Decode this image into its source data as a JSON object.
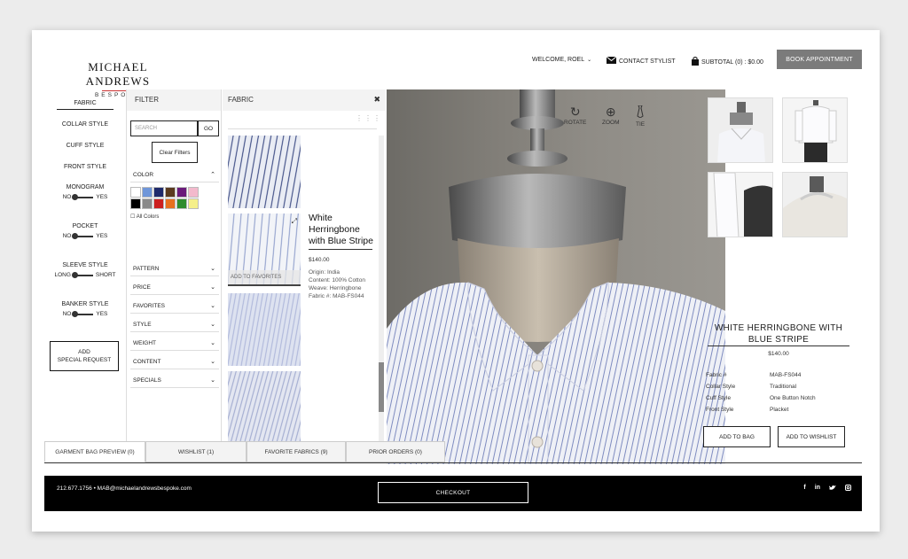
{
  "header": {
    "logo_name": "MICHAEL ANDREWS",
    "logo_sub": "BESPOKE",
    "welcome": "WELCOME, ROEL",
    "contact": "CONTACT STYLIST",
    "subtotal": "SUBTOTAL (0) : $0.00",
    "book": "BOOK APPOINTMENT"
  },
  "leftnav": {
    "fabric": "FABRIC",
    "collar": "COLLAR STYLE",
    "cuff": "CUFF STYLE",
    "front": "FRONT STYLE",
    "monogram": "MONOGRAM",
    "pocket": "POCKET",
    "sleeve": "SLEEVE STYLE",
    "banker": "BANKER STYLE",
    "no": "NO",
    "yes": "YES",
    "long": "LONG",
    "short": "SHORT",
    "special_l1": "ADD",
    "special_l2": "SPECIAL REQUEST"
  },
  "filter": {
    "title": "FILTER",
    "search_placeholder": "SEARCH",
    "go": "GO",
    "clear": "Clear Filters",
    "color": "COLOR",
    "all_colors": "All Colors",
    "rows": [
      "PATTERN",
      "PRICE",
      "FAVORITES",
      "STYLE",
      "WEIGHT",
      "CONTENT",
      "SPECIALS"
    ],
    "swatch_colors": [
      "#ffffff",
      "#6f96d9",
      "#1f2a6b",
      "#5a3a1e",
      "#6a1a7a",
      "#f3b9cc",
      "#000000",
      "#8a8a8a",
      "#cc1f1f",
      "#e8701e",
      "#2e8b2e",
      "#f5ef8a"
    ]
  },
  "fabric": {
    "title": "FABRIC",
    "add_fav": "ADD TO FAVORITES",
    "name": "White Herringbone with Blue Stripe",
    "price": "$140.00",
    "origin": "Origin: India",
    "content": "Content: 100% Cotton",
    "weave": "Weave: Herringbone",
    "fabric_no": "Fabric #: MAB-FS044"
  },
  "viewer": {
    "rotate": "ROTATE",
    "zoom": "ZOOM",
    "tie": "TIE"
  },
  "product": {
    "title": "WHITE HERRINGBONE WITH BLUE STRIPE",
    "price": "$140.00",
    "specs": [
      {
        "k": "Fabric #",
        "v": "MAB-FS044"
      },
      {
        "k": "Collar Style",
        "v": "Traditional"
      },
      {
        "k": "Cuff Style",
        "v": "One Button Notch"
      },
      {
        "k": "Front Style",
        "v": "Placket"
      }
    ],
    "add_bag": "ADD TO BAG",
    "add_wishlist": "ADD TO WISHLIST"
  },
  "tabs": [
    "GARMENT BAG PREVIEW (0)",
    "WISHLIST (1)",
    "FAVORITE FABRICS (9)",
    "PRIOR ORDERS (0)"
  ],
  "footer": {
    "contact": "212.677.1756 • MAB@michaelandrewsbespoke.com",
    "checkout": "CHECKOUT",
    "social": [
      "f",
      "in",
      "t",
      "ig"
    ]
  }
}
